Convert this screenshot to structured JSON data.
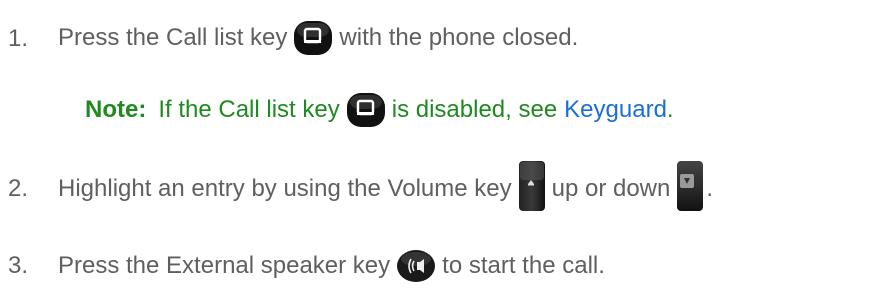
{
  "steps": [
    {
      "number": "1.",
      "before": "Press the Call list key",
      "after": "with the phone closed.",
      "icon": "call-list-key-icon"
    },
    {
      "number": "2.",
      "before": "Highlight an entry by using the Volume key",
      "middle": "up or down",
      "after": ".",
      "icons": [
        "volume-up-key-icon",
        "volume-down-key-icon"
      ]
    },
    {
      "number": "3.",
      "before": "Press the External speaker key",
      "after": "to start the call.",
      "icon": "external-speaker-key-icon"
    }
  ],
  "note": {
    "label": "Note:",
    "before": "If the Call list key",
    "after": "is disabled, see",
    "link_text": "Keyguard",
    "end": ".",
    "icon": "call-list-key-icon"
  },
  "colors": {
    "body_text": "#5f5f5f",
    "note_text": "#1f8a1f",
    "link": "#1a6fd6"
  }
}
